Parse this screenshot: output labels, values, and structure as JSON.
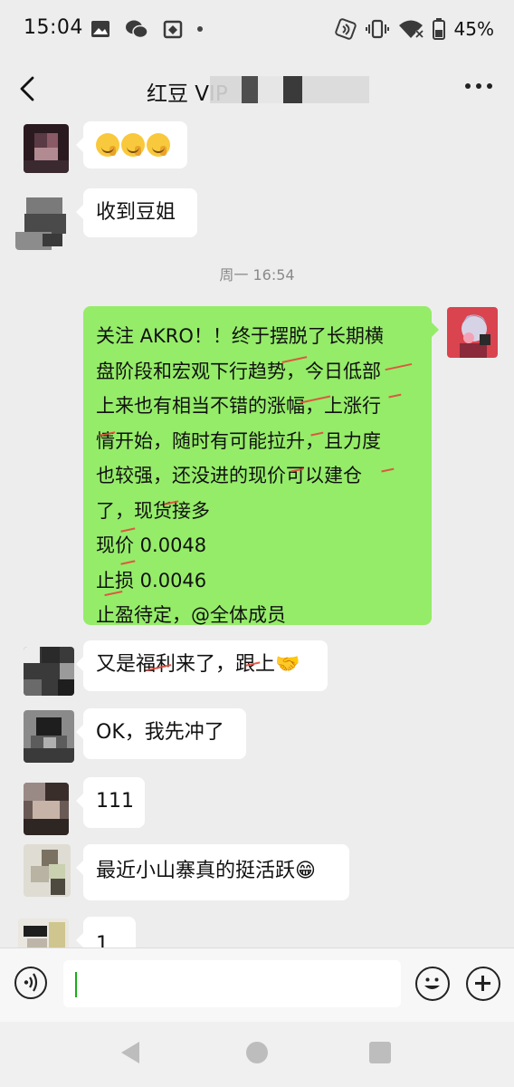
{
  "status_bar": {
    "time": "15:04",
    "battery": "45%",
    "icons_left": [
      "photo-icon",
      "wechat-icon",
      "app-icon"
    ],
    "icons_right": [
      "nfc-icon",
      "vibrate-icon",
      "wifi-icon",
      "battery-icon"
    ]
  },
  "header": {
    "title": "红豆 VIP"
  },
  "chat": {
    "messages": [
      {
        "side": "left",
        "text": ""
      },
      {
        "side": "left",
        "text": "收到豆姐"
      },
      {
        "side": "timestamp",
        "text": "周一 16:54"
      },
      {
        "side": "right",
        "lines": [
          "关注 AKRO！！终于摆脱了长期横",
          "盘阶段和宏观下行趋势，今日低部",
          "上来也有相当不错的涨幅，上涨行",
          "情开始，随时有可能拉升，且力度",
          "也较强，还没进的现价可以建仓",
          "了，现货接多",
          "现价 0.0048",
          "止损 0.0046",
          "止盈待定，@全体成员"
        ]
      },
      {
        "side": "left",
        "text": "又是福利来了，跟上🤝"
      },
      {
        "side": "left",
        "text": "OK，我先冲了"
      },
      {
        "side": "left",
        "text": "111"
      },
      {
        "side": "left",
        "text": "最近小山寨真的挺活跃😁"
      },
      {
        "side": "left",
        "text": "1"
      }
    ]
  },
  "input_bar": {
    "value": ""
  },
  "colors": {
    "background": "#ededed",
    "own_bubble": "#95ec69",
    "other_bubble": "#ffffff",
    "accent": "#1aad19"
  }
}
